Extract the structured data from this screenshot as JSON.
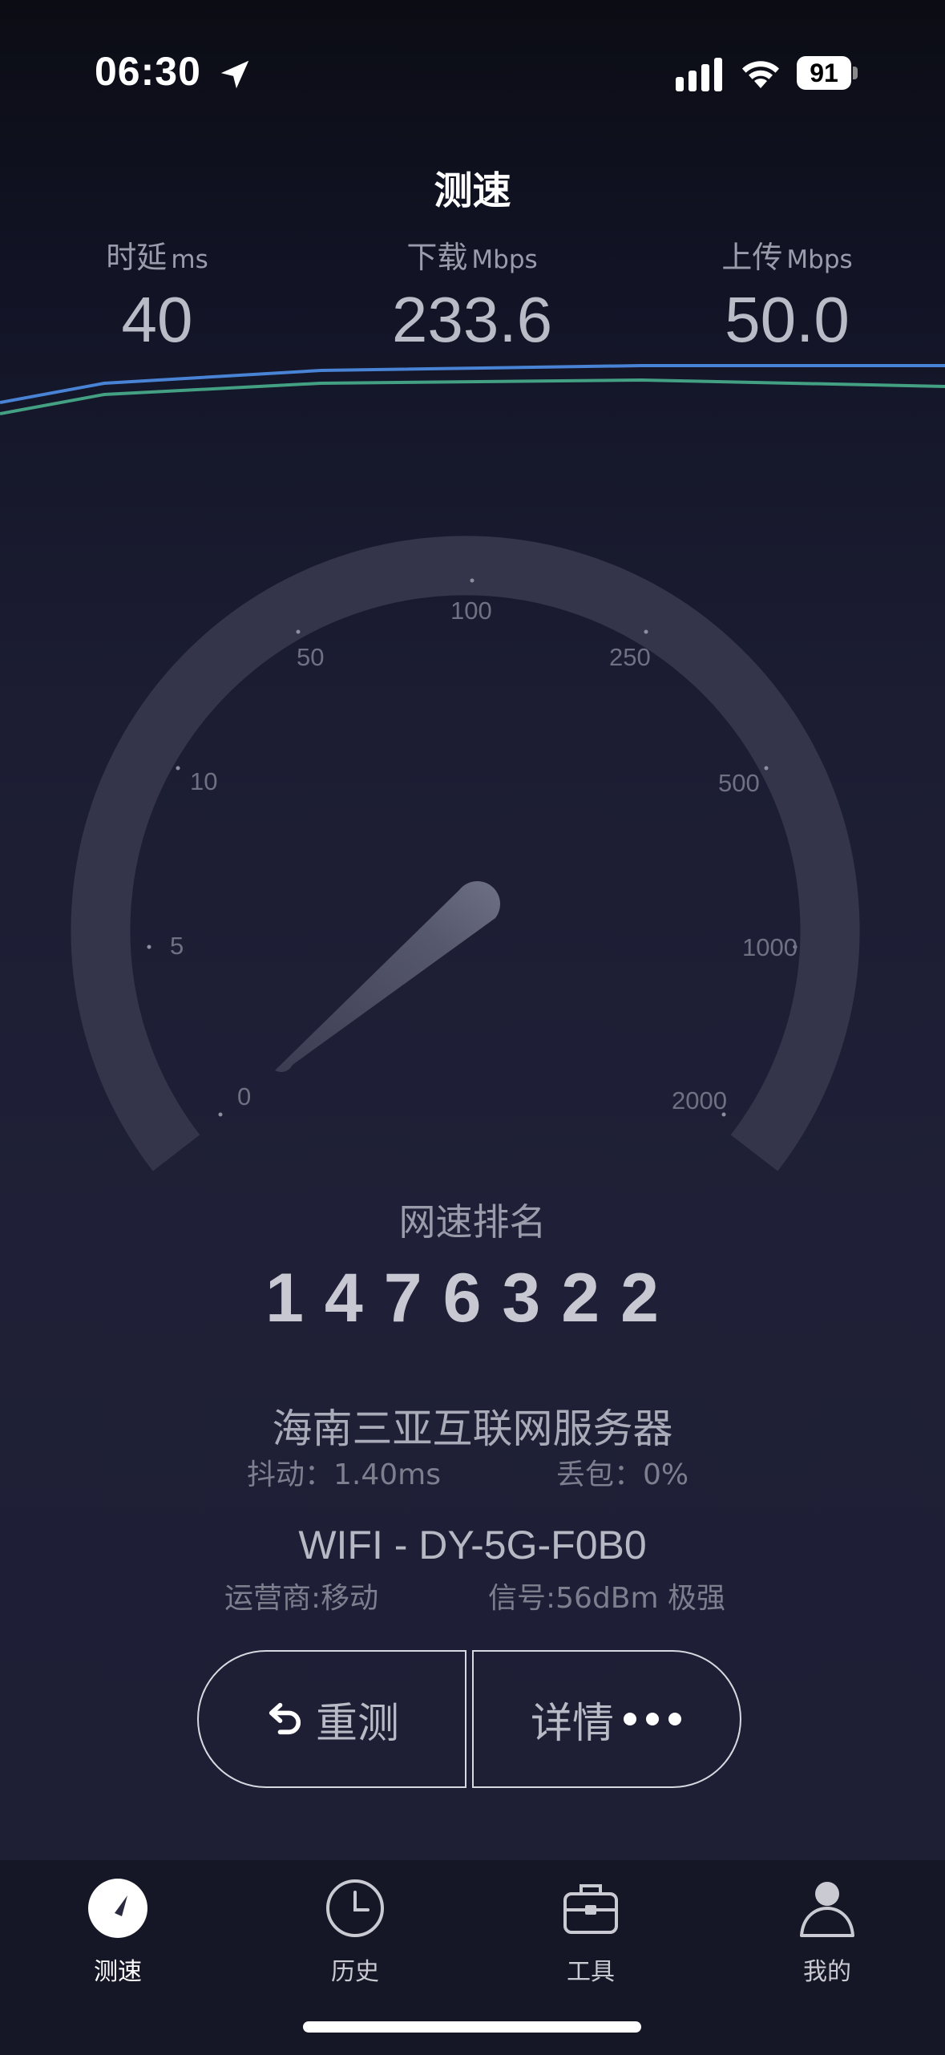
{
  "status_bar": {
    "time": "06:30",
    "battery": "91"
  },
  "header": {
    "title": "测速"
  },
  "metrics": {
    "latency": {
      "label": "时延",
      "unit": "ms",
      "value": "40"
    },
    "download": {
      "label": "下载",
      "unit": "Mbps",
      "value": "233.6"
    },
    "upload": {
      "label": "上传",
      "unit": "Mbps",
      "value": "50.0"
    }
  },
  "gauge": {
    "ticks": [
      "0",
      "5",
      "10",
      "50",
      "100",
      "250",
      "500",
      "1000",
      "2000"
    ]
  },
  "ranking": {
    "label": "网速排名",
    "value": "1476322"
  },
  "server": {
    "name": "海南三亚互联网服务器",
    "jitter_label": "抖动：",
    "jitter_value": "1.40ms",
    "loss_label": "丢包：",
    "loss_value": "0%"
  },
  "network": {
    "name": "WIFI - DY-5G-F0B0",
    "carrier_text": "运营商:移动",
    "signal_text": "信号:56dBm 极强"
  },
  "actions": {
    "retest_label": "重测",
    "detail_label": "详情"
  },
  "tab_bar": {
    "tabs": [
      {
        "label": "测速",
        "icon": "gauge-icon"
      },
      {
        "label": "历史",
        "icon": "clock-icon"
      },
      {
        "label": "工具",
        "icon": "toolbox-icon"
      },
      {
        "label": "我的",
        "icon": "user-icon"
      }
    ]
  },
  "colors": {
    "background": "#1f2037",
    "download_line": "#4f8fe8",
    "upload_line": "#4fc39a",
    "gauge_track": "#34344a"
  }
}
